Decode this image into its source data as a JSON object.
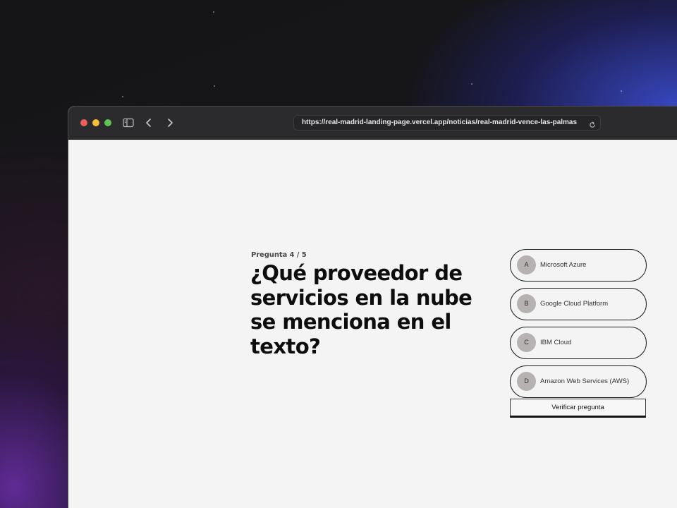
{
  "browser": {
    "url": "https://real-madrid-landing-page.vercel.app/noticias/real-madrid-vence-las-palmas",
    "icons": {
      "sidebar": "sidebar-icon",
      "back": "chevron-left-icon",
      "forward": "chevron-right-icon",
      "reload": "reload-icon"
    }
  },
  "quiz": {
    "counter": "Pregunta 4 / 5",
    "question": "¿Qué proveedor de servicios en la nube se menciona en el texto?",
    "options": [
      {
        "letter": "A",
        "label": "Microsoft Azure"
      },
      {
        "letter": "B",
        "label": "Google Cloud Platform"
      },
      {
        "letter": "C",
        "label": "IBM Cloud"
      },
      {
        "letter": "D",
        "label": "Amazon Web Services (AWS)"
      }
    ],
    "verify_label": "Verificar pregunta"
  },
  "colors": {
    "page_background": "#f4f4f4",
    "titlebar": "#2b2b2d",
    "option_badge": "#b6b2b2",
    "traffic_red": "#ee5f57",
    "traffic_yellow": "#f4bd3b",
    "traffic_green": "#5fc453"
  }
}
